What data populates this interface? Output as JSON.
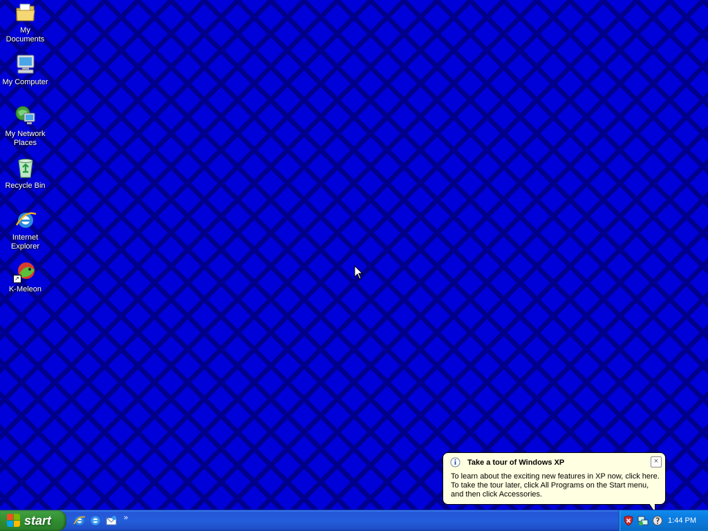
{
  "desktop": {
    "icons": [
      {
        "label": "My Documents",
        "icon": "my-documents-icon"
      },
      {
        "label": "My Computer",
        "icon": "my-computer-icon"
      },
      {
        "label": "My Network Places",
        "icon": "network-places-icon"
      },
      {
        "label": "Recycle Bin",
        "icon": "recycle-bin-icon"
      },
      {
        "label": "Internet Explorer",
        "icon": "internet-explorer-icon"
      },
      {
        "label": "K-Meleon",
        "icon": "k-meleon-icon"
      }
    ]
  },
  "taskbar": {
    "start_label": "start",
    "quick_launch": [
      "internet-explorer-icon",
      "internet-explorer-icon",
      "outlook-express-icon"
    ],
    "chevron": "»",
    "tray_icons": [
      "security-alert-icon",
      "network-icon",
      "tour-icon"
    ],
    "clock": "1:44 PM"
  },
  "balloon": {
    "title": "Take a tour of Windows XP",
    "line1": "To learn about the exciting new features in XP now, click here.",
    "line2": "To take the tour later, click All Programs on the Start menu,",
    "line3": "and then click Accessories.",
    "close": "×"
  },
  "colors": {
    "desktop_bg": "#0000d8",
    "pattern": "#00008c",
    "taskbar": "#245edb",
    "start": "#3c9b3c",
    "tray": "#0c7ee2",
    "balloon": "#ffffe1"
  }
}
